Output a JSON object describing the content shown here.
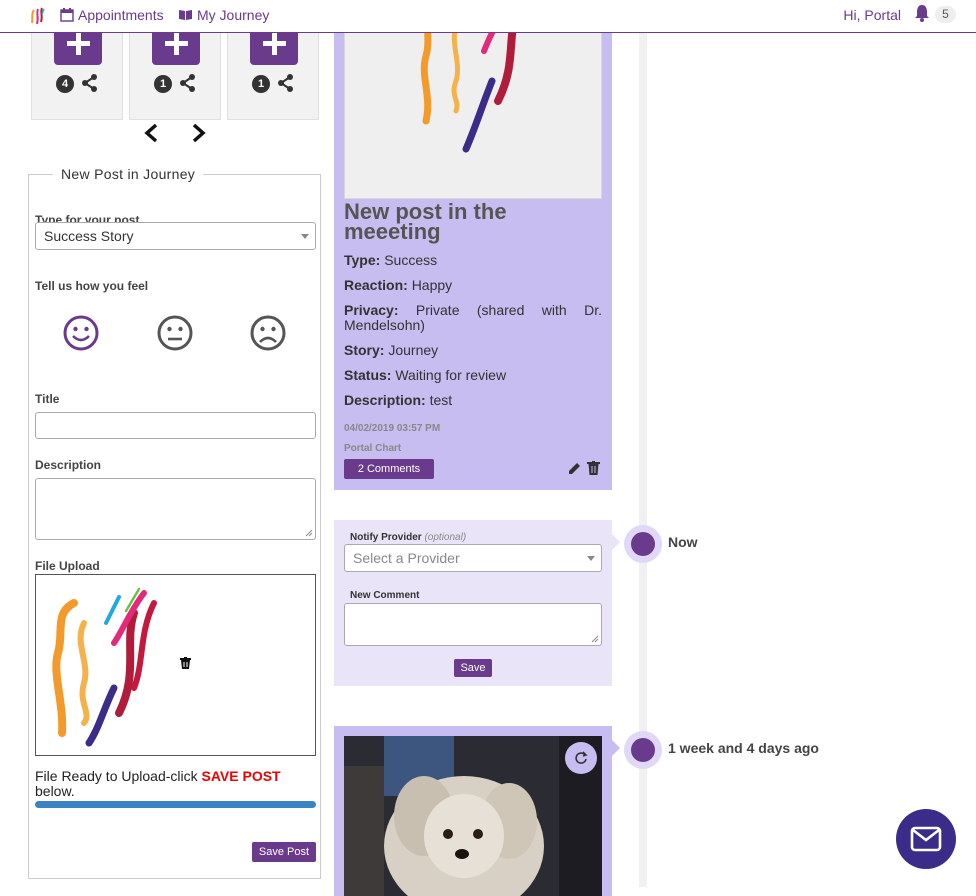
{
  "nav": {
    "appointments": "Appointments",
    "journey": "My Journey",
    "greeting": "Hi, Portal",
    "notification_count": "5"
  },
  "stories": [
    {
      "count": "4"
    },
    {
      "count": "1"
    },
    {
      "count": "1"
    }
  ],
  "new_post": {
    "legend": "New Post in Journey",
    "type_label": "Type for your post",
    "type_value": "Success Story",
    "feel_label": "Tell us how you feel",
    "title_label": "Title",
    "description_label": "Description",
    "upload_label": "File Upload",
    "ready_text_1": "File Ready to Upload-click ",
    "ready_text_em": "SAVE POST",
    "ready_text_2": " below.",
    "upload_progress": 1.0,
    "save_label": "Save Post"
  },
  "post": {
    "title": "New post in the meeeting",
    "type_key": "Type:",
    "type_val": "Success",
    "reaction_key": "Reaction:",
    "reaction_val": "Happy",
    "privacy_key": "Privacy:",
    "privacy_val": "Private (shared with Dr. Mendelsohn)",
    "story_key": "Story:",
    "story_val": "Journey",
    "status_key": "Status:",
    "status_val": "Waiting for review",
    "desc_key": "Description:",
    "desc_val": "test",
    "date": "04/02/2019 03:57 PM",
    "author": "Portal Chart",
    "comments_label": "2 Comments"
  },
  "comment": {
    "notify_label": "Notify Provider",
    "notify_optional": "(optional)",
    "provider_placeholder": "Select a Provider",
    "new_comment_label": "New Comment",
    "save_label": "Save"
  },
  "timeline": {
    "now_label": "Now",
    "past_label": "1 week and 4 days ago"
  },
  "colors": {
    "brand_purple": "#6a3a8c",
    "card_lavender": "#c7bdf0",
    "comment_bg": "#e9e4f7",
    "progress_blue": "#3a84c4"
  }
}
